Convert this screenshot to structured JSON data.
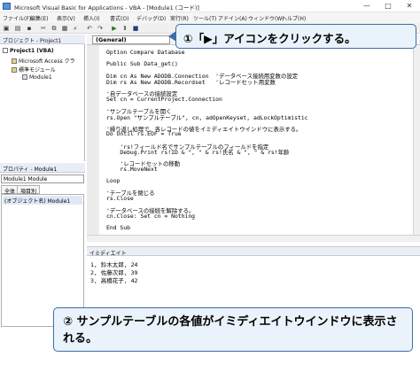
{
  "window": {
    "title": "Microsoft Visual Basic for Applications - VBA - [Module1 (コード)]",
    "minimize": "—",
    "maximize": "□",
    "close": "✕"
  },
  "menu": [
    "ファイル(F)",
    "編集(E)",
    "表示(V)",
    "挿入(I)",
    "書式(O)",
    "デバッグ(D)",
    "実行(R)",
    "ツール(T)",
    "アドイン(A)",
    "ウィンドウ(W)",
    "ヘルプ(H)"
  ],
  "toolbar": {
    "icons": [
      "excel-icon",
      "insert-icon",
      "save-icon",
      "cut-icon",
      "copy-icon",
      "paste-icon",
      "find-icon",
      "undo-icon",
      "redo-icon",
      "run-icon",
      "break-icon",
      "reset-icon"
    ],
    "glyphs": [
      "▣",
      "▤",
      "▪",
      "✂",
      "⧉",
      "▦",
      "⌕",
      "↶",
      "↷",
      "▶",
      "Ⅱ",
      "■"
    ]
  },
  "project": {
    "title": "プロジェクト - Project1",
    "items": [
      {
        "label": "Project1 (VBA)"
      },
      {
        "label": "Microsoft Access クラ"
      },
      {
        "label": "標準モジュール"
      },
      {
        "label": "Module1"
      }
    ]
  },
  "properties": {
    "title": "プロパティ - Module1",
    "combo": "Module1  Module",
    "tabs": [
      "全体",
      "項目別"
    ],
    "row": "(オブジェクト名)  Module1"
  },
  "code": {
    "object_combo": "(General)",
    "lines": [
      {
        "t": "Option Compare Database",
        "c": "kw"
      },
      {
        "t": "",
        "c": ""
      },
      {
        "t": "Public Sub Data_get()",
        "c": "kw"
      },
      {
        "t": "",
        "c": ""
      },
      {
        "t": "Dim cn As New ADODB.Connection  'データベース接続用変数の設定",
        "c": ""
      },
      {
        "t": "Dim rs As New ADODB.Recordset   'レコードセット用変数",
        "c": ""
      },
      {
        "t": "",
        "c": ""
      },
      {
        "t": "'自データベースの接続設定",
        "c": "cm"
      },
      {
        "t": "Set cn = CurrentProject.Connection",
        "c": ""
      },
      {
        "t": "",
        "c": ""
      },
      {
        "t": "'サンプルテーブルを開く",
        "c": "cm"
      },
      {
        "t": "rs.Open \"サンプルテーブル\", cn, adOpenKeyset, adLockOptimistic",
        "c": ""
      },
      {
        "t": "",
        "c": ""
      },
      {
        "t": "'繰り返し処理で、各レコードの値をイミディエイトウインドウに表示する。",
        "c": "cm"
      },
      {
        "t": "Do Until rs.EOF = True",
        "c": "kw"
      },
      {
        "t": "",
        "c": ""
      },
      {
        "t": "    'rs!フィールド名でサンプルテーブルのフィールドを指定",
        "c": "cm"
      },
      {
        "t": "    Debug.Print rs!ID & \", \" & rs!氏名 & \", \" & rs!年齢",
        "c": ""
      },
      {
        "t": "",
        "c": ""
      },
      {
        "t": "    'レコードセットの移動",
        "c": "cm"
      },
      {
        "t": "    rs.MoveNext",
        "c": ""
      },
      {
        "t": "",
        "c": ""
      },
      {
        "t": "Loop",
        "c": "kw"
      },
      {
        "t": "",
        "c": ""
      },
      {
        "t": "'テーブルを閉じる",
        "c": "cm"
      },
      {
        "t": "rs.Close",
        "c": ""
      },
      {
        "t": "",
        "c": ""
      },
      {
        "t": "'データベースの接続を解除する。",
        "c": "cm"
      },
      {
        "t": "cn.Close: Set cn = Nothing",
        "c": ""
      },
      {
        "t": "",
        "c": ""
      },
      {
        "t": "End Sub",
        "c": "kw"
      }
    ]
  },
  "immediate": {
    "title": "イミディエイト",
    "lines": [
      "1, 鈴木太郎, 24",
      "2, 佐藤次郎, 39",
      "3, 高橋花子, 42"
    ]
  },
  "callouts": {
    "first": "①「▶」アイコンをクリックする。",
    "second": "② サンプルテーブルの各値がイミディエイトウインドウに表示される。"
  },
  "colors": {
    "callout_border": "#3b6ea8",
    "callout_fill": "#eaf3fb",
    "keyword": "#00008b",
    "comment": "#148a14"
  }
}
